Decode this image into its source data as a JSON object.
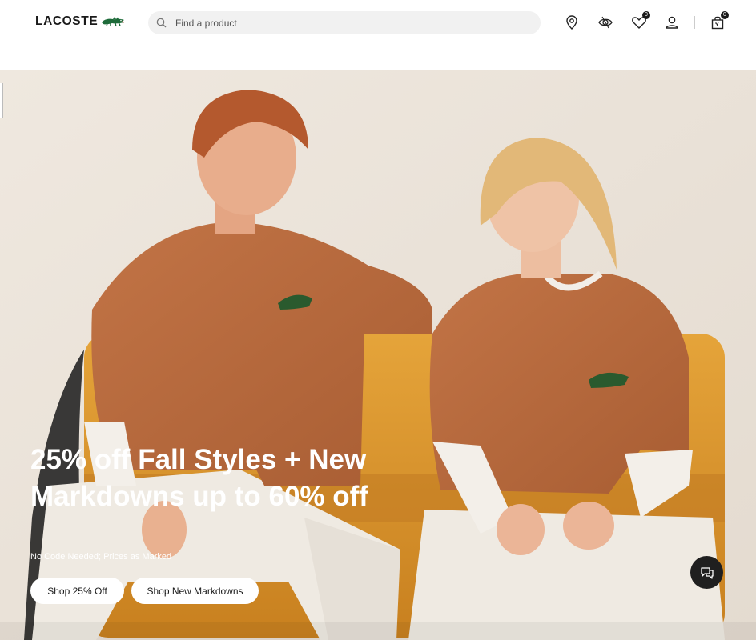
{
  "brand": {
    "logo_text": "LACOSTE",
    "brand_green": "#1e6b3a"
  },
  "search": {
    "placeholder": "Find a product"
  },
  "header": {
    "wishlist_count": "0",
    "cart_count": "0",
    "icons": [
      "store-locator-icon",
      "watch-icon",
      "wishlist-heart-icon",
      "account-icon",
      "cart-bag-icon"
    ]
  },
  "hero": {
    "headline": "25% off Fall Styles + New Markdowns up to 60% off",
    "subline": "No Code Needed; Prices as Marked",
    "buttons": {
      "primary_label": "Shop 25% Off",
      "secondary_label": "Shop New Markdowns"
    },
    "colors": {
      "background": "#ebe3da",
      "sweater": "#b86a3d",
      "couch": "#d9962c",
      "pants": "#efeae2"
    }
  },
  "chat": {
    "icon": "chat-bubbles-icon"
  }
}
